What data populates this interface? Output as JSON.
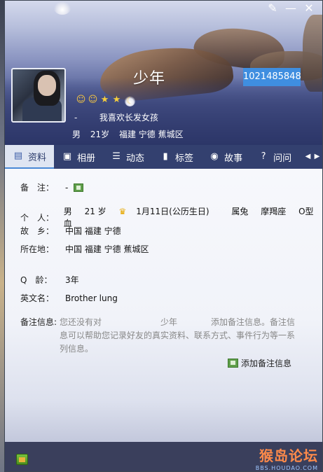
{
  "window": {
    "controls": [
      {
        "name": "skin-button",
        "glyph": "✎"
      },
      {
        "name": "minimize-button",
        "glyph": "—"
      },
      {
        "name": "close-button",
        "glyph": "✕"
      }
    ]
  },
  "profile": {
    "nickname": "少年",
    "qq_number": "1021485848",
    "signature_prefix": "-",
    "signature": "我喜欢长发女孩",
    "gender": "男",
    "age": "21岁",
    "location": "福建 宁德 蕉城区",
    "level_icons": [
      "sun-icon",
      "sun-icon",
      "moon-icon",
      "star-icon",
      "star-icon"
    ]
  },
  "tabs": [
    {
      "label": "资料",
      "icon": "profile-card-icon",
      "glyph": "▤",
      "active": true
    },
    {
      "label": "相册",
      "icon": "photo-album-icon",
      "glyph": "▣",
      "active": false
    },
    {
      "label": "动态",
      "icon": "feed-list-icon",
      "glyph": "☰",
      "active": false
    },
    {
      "label": "标签",
      "icon": "bookmark-icon",
      "glyph": "▮",
      "active": false
    },
    {
      "label": "故事",
      "icon": "signal-icon",
      "glyph": "◉",
      "active": false
    },
    {
      "label": "问问",
      "icon": "question-icon",
      "glyph": "?",
      "active": false
    }
  ],
  "tab_nav": {
    "left": "◀",
    "right": "▶"
  },
  "details": {
    "remark": {
      "label": "备　注：",
      "value": "-"
    },
    "personal": {
      "label": "个　人：",
      "gender": "男",
      "age": "21 岁",
      "birthday": "1月11日(公历生日)",
      "zodiac": "属兔",
      "constellation": "摩羯座",
      "blood": "O型血"
    },
    "hometown": {
      "label": "故　乡：",
      "value": "中国 福建 宁德"
    },
    "residence": {
      "label": "所在地：",
      "value": "中国 福建 宁德 蕉城区"
    },
    "qage": {
      "label": "Q　龄：",
      "value": "3年"
    },
    "english_name": {
      "label": "英文名：",
      "value": "Brother lung"
    }
  },
  "memo": {
    "label": "备注信息:",
    "text": "您还没有对　　　　　　　少年　　　　添加备注信息。备注信息可以帮助您记录好友的真实资料、联系方式、事件行为等一系列信息。",
    "add_label": "添加备注信息"
  },
  "watermark": {
    "line1": "猴岛论坛",
    "line2": "BBS.HOUDAO.COM"
  }
}
